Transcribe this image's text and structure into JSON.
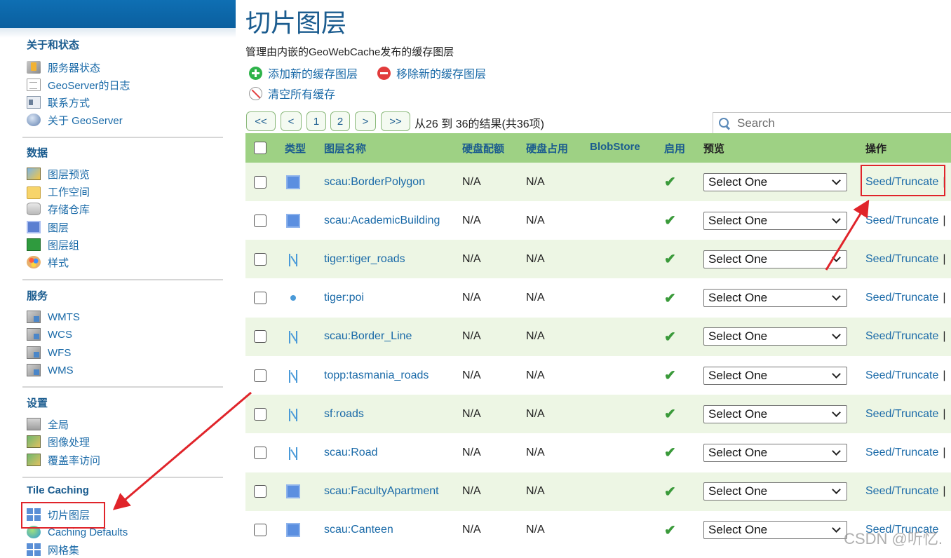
{
  "sidebar": {
    "sections": [
      {
        "title": "关于和状态",
        "items": [
          {
            "label": "服务器状态",
            "icon": "server-status-icon"
          },
          {
            "label": "GeoServer的日志",
            "icon": "log-document-icon"
          },
          {
            "label": "联系方式",
            "icon": "contact-card-icon"
          },
          {
            "label": "关于 GeoServer",
            "icon": "about-icon"
          }
        ]
      },
      {
        "title": "数据",
        "items": [
          {
            "label": "图层预览",
            "icon": "layer-preview-icon"
          },
          {
            "label": "工作空间",
            "icon": "folder-icon"
          },
          {
            "label": "存储仓库",
            "icon": "database-icon"
          },
          {
            "label": "图层",
            "icon": "layer-icon"
          },
          {
            "label": "图层组",
            "icon": "layer-group-icon"
          },
          {
            "label": "样式",
            "icon": "palette-icon"
          }
        ]
      },
      {
        "title": "服务",
        "items": [
          {
            "label": "WMTS",
            "icon": "service-icon"
          },
          {
            "label": "WCS",
            "icon": "service-icon"
          },
          {
            "label": "WFS",
            "icon": "service-icon"
          },
          {
            "label": "WMS",
            "icon": "service-icon"
          }
        ]
      },
      {
        "title": "设置",
        "items": [
          {
            "label": "全局",
            "icon": "settings-icon"
          },
          {
            "label": "图像处理",
            "icon": "image-processing-icon"
          },
          {
            "label": "覆盖率访问",
            "icon": "coverage-access-icon"
          }
        ]
      },
      {
        "title": "Tile Caching",
        "items": [
          {
            "label": "切片图层",
            "icon": "tile-layers-icon"
          },
          {
            "label": "Caching Defaults",
            "icon": "globe-icon"
          },
          {
            "label": "网格集",
            "icon": "gridset-icon"
          }
        ]
      }
    ]
  },
  "main": {
    "title": "切片图层",
    "description": "管理由内嵌的GeoWebCache发布的缓存图层",
    "actions": {
      "add": "添加新的缓存图层",
      "remove": "移除新的缓存图层",
      "clear": "清空所有缓存"
    },
    "pager": {
      "first": "<<",
      "prev": "<",
      "page1": "1",
      "page2": "2",
      "next": ">",
      "last": ">>",
      "info": "从26 到 36的结果(共36项)"
    },
    "search": {
      "placeholder": "Search"
    },
    "table": {
      "headers": {
        "type": "类型",
        "name": "图层名称",
        "disk_quota": "硬盘配额",
        "disk_usage": "硬盘占用",
        "blobstore": "BlobStore",
        "enabled": "启用",
        "preview": "预览",
        "actions": "操作"
      },
      "rows": [
        {
          "type": "polygon",
          "name": "scau:BorderPolygon",
          "quota": "N/A",
          "usage": "N/A",
          "preview": "Select One",
          "action": "Seed/Truncate",
          "sep": "|"
        },
        {
          "type": "polygon",
          "name": "scau:AcademicBuilding",
          "quota": "N/A",
          "usage": "N/A",
          "preview": "Select One",
          "action": "Seed/Truncate",
          "sep": "|"
        },
        {
          "type": "line",
          "name": "tiger:tiger_roads",
          "quota": "N/A",
          "usage": "N/A",
          "preview": "Select One",
          "action": "Seed/Truncate",
          "sep": "|"
        },
        {
          "type": "point",
          "name": "tiger:poi",
          "quota": "N/A",
          "usage": "N/A",
          "preview": "Select One",
          "action": "Seed/Truncate",
          "sep": "|"
        },
        {
          "type": "line",
          "name": "scau:Border_Line",
          "quota": "N/A",
          "usage": "N/A",
          "preview": "Select One",
          "action": "Seed/Truncate",
          "sep": "|"
        },
        {
          "type": "line",
          "name": "topp:tasmania_roads",
          "quota": "N/A",
          "usage": "N/A",
          "preview": "Select One",
          "action": "Seed/Truncate",
          "sep": "|"
        },
        {
          "type": "line",
          "name": "sf:roads",
          "quota": "N/A",
          "usage": "N/A",
          "preview": "Select One",
          "action": "Seed/Truncate",
          "sep": "|"
        },
        {
          "type": "line",
          "name": "scau:Road",
          "quota": "N/A",
          "usage": "N/A",
          "preview": "Select One",
          "action": "Seed/Truncate",
          "sep": "|"
        },
        {
          "type": "polygon",
          "name": "scau:FacultyApartment",
          "quota": "N/A",
          "usage": "N/A",
          "preview": "Select One",
          "action": "Seed/Truncate",
          "sep": "|"
        },
        {
          "type": "polygon",
          "name": "scau:Canteen",
          "quota": "N/A",
          "usage": "N/A",
          "preview": "Select One",
          "action": "Seed/Truncate",
          "sep": ""
        }
      ]
    }
  },
  "watermark": "CSDN @听忆.",
  "colors": {
    "header_green": "#9ed184",
    "row_alt": "#edf6e4",
    "link_blue": "#1a6aa8",
    "title_blue": "#1b5c8f",
    "annotation_red": "#e0242a"
  }
}
